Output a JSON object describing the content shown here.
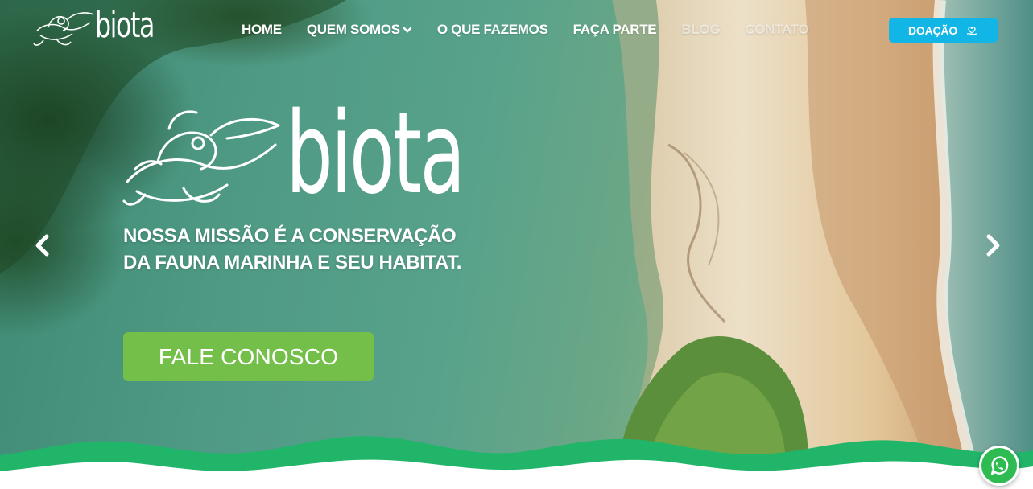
{
  "brand": {
    "name": "biota",
    "colors": {
      "accent_green": "#74bf49",
      "wave_green": "#21b56a",
      "donate_blue": "#12b6e6",
      "whatsapp": "#2dbb52"
    }
  },
  "header": {
    "nav": [
      {
        "label": "HOME",
        "icon": null
      },
      {
        "label": "QUEM SOMOS",
        "icon": "chevron-down-icon"
      },
      {
        "label": "O QUE FAZEMOS",
        "icon": null
      },
      {
        "label": "FAÇA PARTE",
        "icon": null
      },
      {
        "label": "BLOG",
        "icon": null
      },
      {
        "label": "CONTATO",
        "icon": null
      }
    ],
    "donate_label": "DOAÇÃO",
    "donate_icon": "hand-heart-icon"
  },
  "hero": {
    "mission_line1": "NOSSA MISSÃO É A CONSERVAÇÃO",
    "mission_line2": "DA FAUNA MARINHA E SEU HABITAT.",
    "cta_label": "FALE CONOSCO",
    "prev_icon": "chevron-left-icon",
    "next_icon": "chevron-right-icon"
  },
  "floating": {
    "whatsapp_icon": "whatsapp-icon"
  }
}
